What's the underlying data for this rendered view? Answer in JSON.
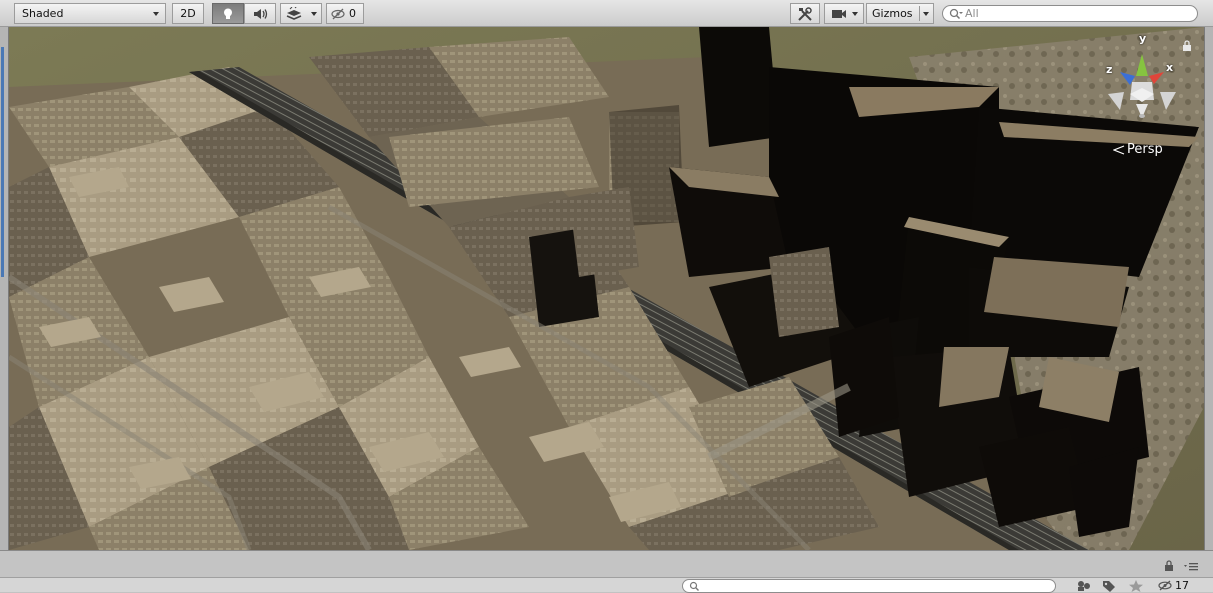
{
  "toolbar": {
    "draw_mode": "Shaded",
    "mode_2d": "2D",
    "gizmos_label": "Gizmos",
    "search_placeholder": "All",
    "hidden_count": "0"
  },
  "scene": {
    "projection_label": "Persp",
    "axes": {
      "y": "y",
      "x": "x",
      "z": "z"
    }
  },
  "bottom": {
    "search_placeholder": "",
    "hidden_count": "17"
  },
  "colors": {
    "toolbar_bg": "#d9d9d9",
    "active_toggle": "#8a8a8a",
    "axis_y": "#86c440",
    "axis_x": "#e0453a",
    "axis_z": "#3b6fd6"
  }
}
